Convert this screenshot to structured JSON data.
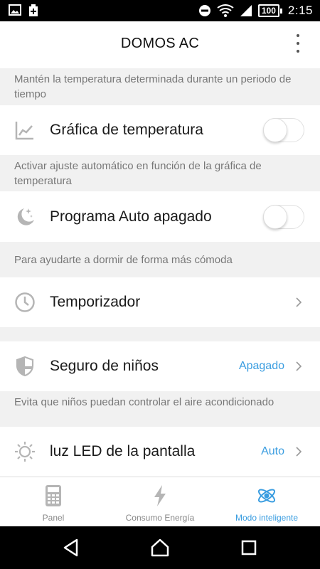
{
  "status_bar": {
    "time": "2:15",
    "battery": "100"
  },
  "header": {
    "title": "DOMOS AC"
  },
  "notes": {
    "hold_temp": "Mantén la temperatura determinada durante un periodo de tiempo",
    "auto_adjust": "Activar ajuste automático en función de la gráfica de temperatura",
    "sleep": "Para ayudarte a dormir de forma más cómoda",
    "child_lock": "Evita que niños puedan controlar el aire acondicionado"
  },
  "rows": {
    "temp_graph": {
      "label": "Gráfica de temperatura",
      "enabled": false
    },
    "auto_off": {
      "label": "Programa Auto apagado",
      "enabled": false
    },
    "timer": {
      "label": "Temporizador"
    },
    "child_lock": {
      "label": "Seguro de niños",
      "value": "Apagado"
    },
    "led": {
      "label": "luz LED de la pantalla",
      "value": "Auto"
    }
  },
  "tabs": [
    {
      "label": "Panel",
      "icon": "calculator-icon",
      "active": false
    },
    {
      "label": "Consumo Energía",
      "icon": "lightning-icon",
      "active": false
    },
    {
      "label": "Modo inteligente",
      "icon": "atom-icon",
      "active": true
    }
  ],
  "colors": {
    "accent": "#3a9de0",
    "icon_gray": "#b5b5b5",
    "background": "#f1f1f1"
  }
}
